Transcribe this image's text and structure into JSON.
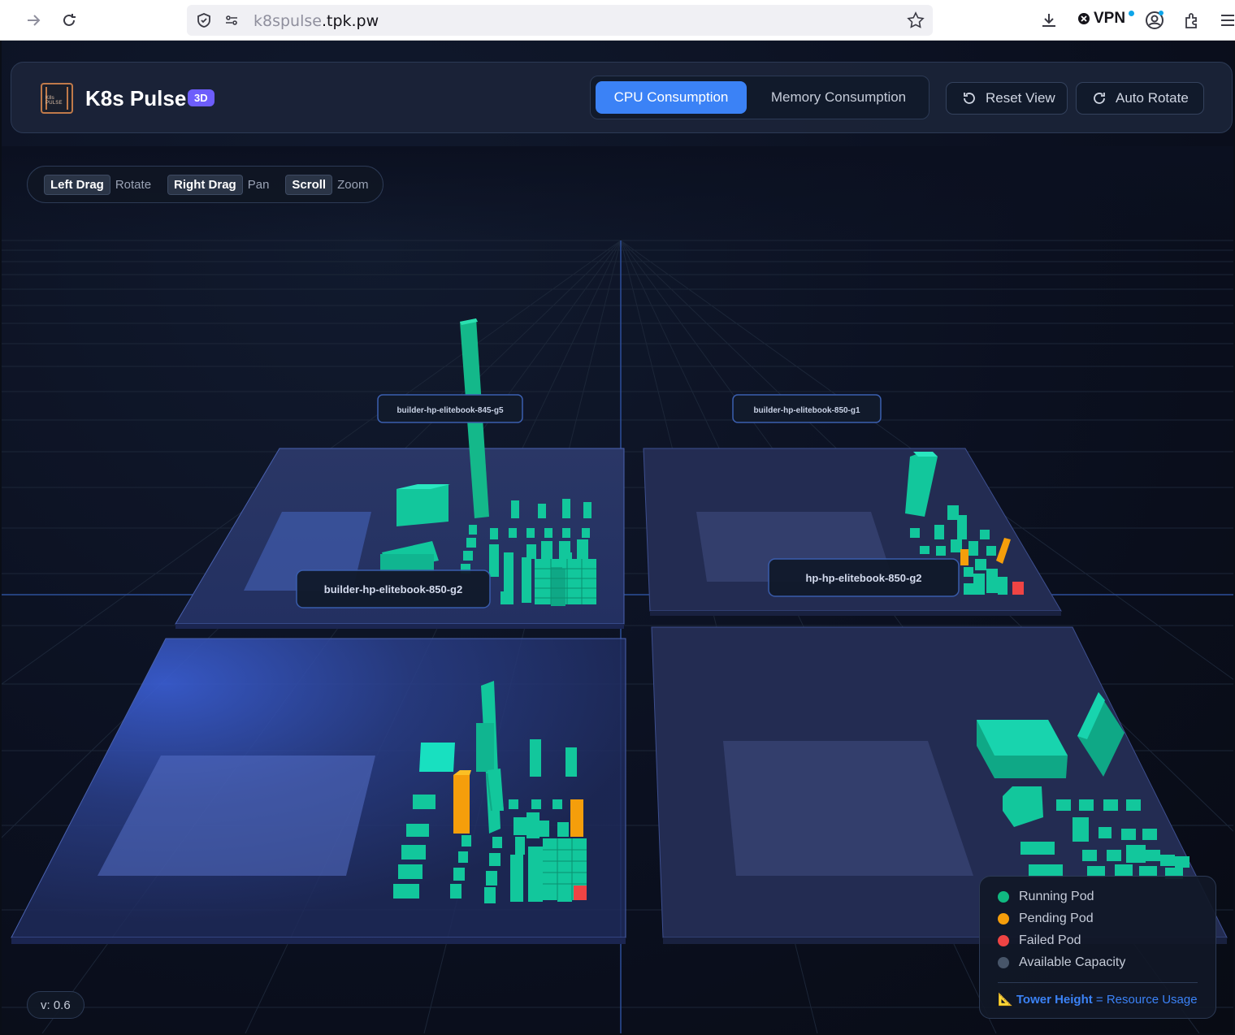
{
  "browser": {
    "url_host": "k8spulse",
    "url_domain": ".tpk.pw",
    "vpn_label": "VPN"
  },
  "app": {
    "title": "K8s Pulse",
    "badge": "3D",
    "logo_text": "K8s PULSE"
  },
  "tabs": {
    "cpu": "CPU Consumption",
    "memory": "Memory Consumption"
  },
  "buttons": {
    "reset": "Reset View",
    "auto_rotate": "Auto Rotate"
  },
  "hints": [
    {
      "key": "Left Drag",
      "action": "Rotate"
    },
    {
      "key": "Right Drag",
      "action": "Pan"
    },
    {
      "key": "Scroll",
      "action": "Zoom"
    }
  ],
  "nodes": {
    "far_left": "builder-hp-elitebook-845-g5",
    "far_right": "builder-hp-elitebook-850-g1",
    "near_left": "builder-hp-elitebook-850-g2",
    "near_right": "hp-hp-elitebook-850-g2"
  },
  "legend": {
    "running": "Running Pod",
    "pending": "Pending Pod",
    "failed": "Failed Pod",
    "available": "Available Capacity",
    "foot_key": "Tower Height",
    "foot_value": "= Resource Usage",
    "colors": {
      "running": "#10b981",
      "pending": "#f59e0b",
      "failed": "#ef4444",
      "available": "#475569"
    }
  },
  "version": "v: 0.6"
}
